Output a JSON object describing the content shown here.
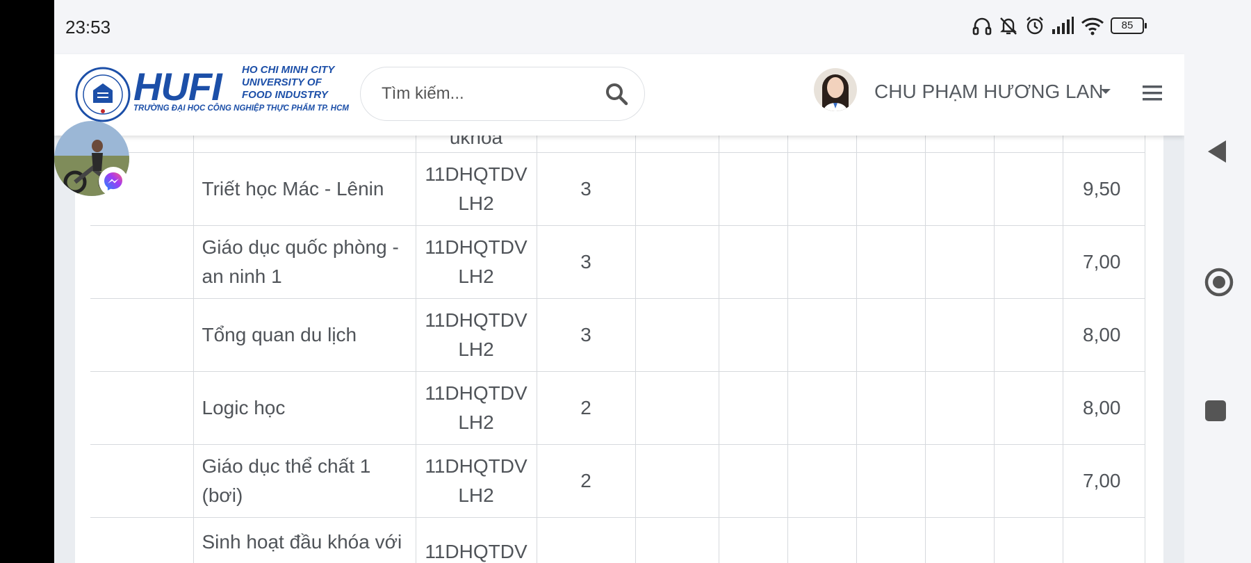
{
  "status_bar": {
    "time": "23:53",
    "battery": "85",
    "icons": [
      "headphones-icon",
      "bell-muted-icon",
      "alarm-icon",
      "signal-icon",
      "wifi-icon",
      "battery-icon"
    ]
  },
  "header": {
    "logo": {
      "brand": "HUFI",
      "line1": "HO CHI MINH CITY",
      "line2": "UNIVERSITY OF",
      "line3": "FOOD INDUSTRY",
      "subtitle": "TRƯỜNG ĐẠI HỌC CÔNG NGHIỆP THỰC PHẨM TP. HCM"
    },
    "search": {
      "placeholder": "Tìm kiếm..."
    },
    "user": {
      "name": "CHU PHẠM HƯƠNG LAN"
    }
  },
  "colors": {
    "brand_blue": "#1c4fa8",
    "table_border": "#d6d9dd",
    "text": "#505459",
    "messenger": "#7a4cf0"
  },
  "grades": {
    "partial_top_class_text": "ukhoá",
    "rows": [
      {
        "subject": "Triết học Mác - Lênin",
        "class_l1": "11DHQTDV",
        "class_l2": "LH2",
        "credits": "3",
        "score": "9,50"
      },
      {
        "subject": "Giáo dục quốc phòng - an ninh 1",
        "class_l1": "11DHQTDV",
        "class_l2": "LH2",
        "credits": "3",
        "score": "7,00"
      },
      {
        "subject": "Tổng quan du lịch",
        "class_l1": "11DHQTDV",
        "class_l2": "LH2",
        "credits": "3",
        "score": "8,00"
      },
      {
        "subject": "Logic học",
        "class_l1": "11DHQTDV",
        "class_l2": "LH2",
        "credits": "2",
        "score": "8,00"
      },
      {
        "subject": "Giáo dục thể chất 1 (bơi)",
        "class_l1": "11DHQTDV",
        "class_l2": "LH2",
        "credits": "2",
        "score": "7,00"
      },
      {
        "subject": "Sinh hoạt đầu khóa với",
        "class_l1": "11DHQTDV",
        "class_l2": "",
        "credits": "",
        "score": ""
      }
    ]
  },
  "nav": {
    "icons": [
      "back-icon",
      "home-icon",
      "recents-icon"
    ]
  }
}
